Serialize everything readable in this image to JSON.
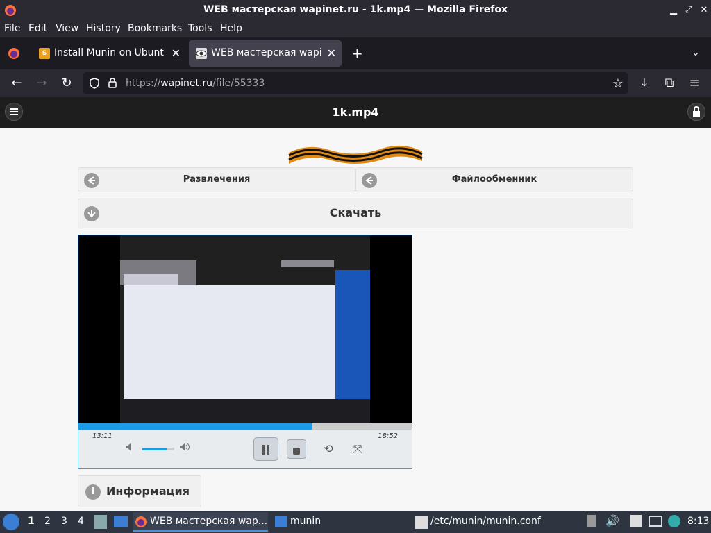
{
  "window": {
    "title": "WEB мастерская wapinet.ru - 1k.mp4 — Mozilla Firefox"
  },
  "menu": [
    "File",
    "Edit",
    "View",
    "History",
    "Bookmarks",
    "Tools",
    "Help"
  ],
  "tabs": [
    {
      "label": "Install Munin on Ubuntu",
      "favicon": "S"
    },
    {
      "label": "WEB мастерская wapinet.ru"
    }
  ],
  "address": {
    "scheme": "https://",
    "host": "wapinet.ru",
    "path": "/file/55333"
  },
  "page": {
    "title": "1k.mp4",
    "nav": [
      "Развлечения",
      "Файлообменник"
    ],
    "download": "Скачать",
    "player": {
      "current": "13:11",
      "duration": "18:52",
      "progress": 0.7,
      "volume": 0.75
    },
    "info": "Информация"
  },
  "taskbar": {
    "workspaces": [
      "1",
      "2",
      "3",
      "4"
    ],
    "tasks": [
      "WEB мастерская wap...",
      "munin",
      "/etc/munin/munin.conf"
    ],
    "clock": "8:13"
  },
  "colors": {
    "accent": "#1e9be6",
    "firefox_bg": "#2b2a33",
    "page_header": "#1e1e1e"
  }
}
